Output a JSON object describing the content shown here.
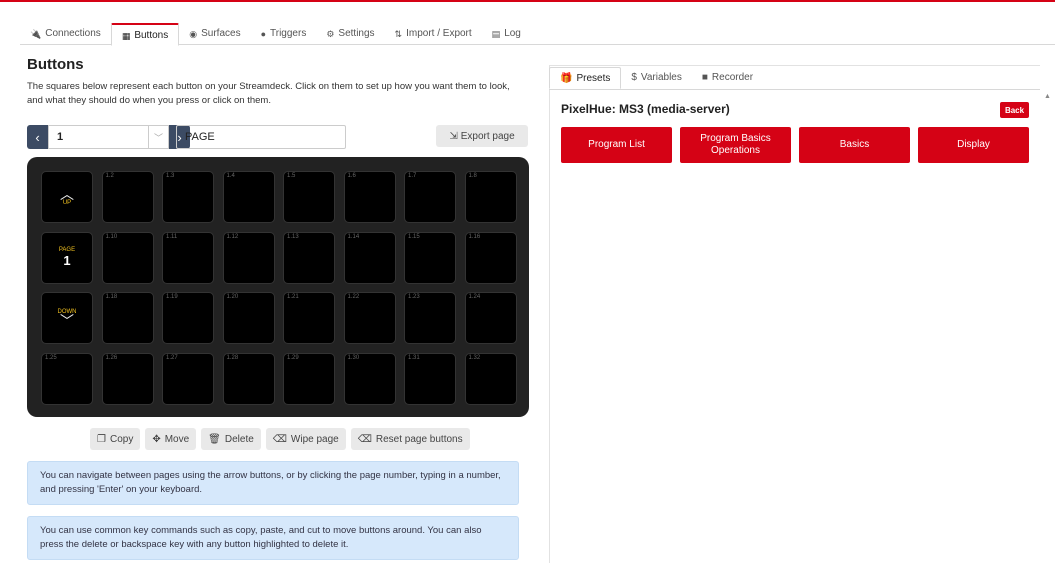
{
  "nav": {
    "tabs": [
      {
        "icon": "plug-icon",
        "glyph": "🔌",
        "label": "Connections"
      },
      {
        "icon": "calculator-icon",
        "glyph": "▦",
        "label": "Buttons",
        "active": true
      },
      {
        "icon": "gamepad-icon",
        "glyph": "◉",
        "label": "Surfaces"
      },
      {
        "icon": "clock-icon",
        "glyph": "●",
        "label": "Triggers"
      },
      {
        "icon": "gear-icon",
        "glyph": "⚙",
        "label": "Settings"
      },
      {
        "icon": "file-import-icon",
        "glyph": "⇅",
        "label": "Import / Export"
      },
      {
        "icon": "clipboard-icon",
        "glyph": "▤",
        "label": "Log"
      }
    ]
  },
  "left": {
    "title": "Buttons",
    "description": "The squares below represent each button on your Streamdeck. Click on them to set up how you want them to look, and what they should do when you press or click on them.",
    "page_number": "1",
    "page_name": "PAGE",
    "export_label": "Export page",
    "nav_buttons": {
      "up": "UP",
      "page": "PAGE",
      "page_num": "1",
      "down": "DOWN"
    },
    "grid_labels": [
      [
        "",
        "1.2",
        "1.3",
        "1.4",
        "1.5",
        "1.6",
        "1.7",
        "1.8"
      ],
      [
        "",
        "1.10",
        "1.11",
        "1.12",
        "1.13",
        "1.14",
        "1.15",
        "1.16"
      ],
      [
        "",
        "1.18",
        "1.19",
        "1.20",
        "1.21",
        "1.22",
        "1.23",
        "1.24"
      ],
      [
        "1.25",
        "1.26",
        "1.27",
        "1.28",
        "1.29",
        "1.30",
        "1.31",
        "1.32"
      ]
    ],
    "actions": [
      {
        "icon": "copy-icon",
        "glyph": "❐",
        "label": "Copy"
      },
      {
        "icon": "move-icon",
        "glyph": "✥",
        "label": "Move"
      },
      {
        "icon": "trash-icon",
        "glyph": "🗑",
        "label": "Delete"
      },
      {
        "icon": "eraser-icon",
        "glyph": "⌫",
        "label": "Wipe page"
      },
      {
        "icon": "eraser-icon",
        "glyph": "⌫",
        "label": "Reset page buttons"
      }
    ],
    "info1": "You can navigate between pages using the arrow buttons, or by clicking the page number, typing in a number, and pressing 'Enter' on your keyboard.",
    "info2": "You can use common key commands such as copy, paste, and cut to move buttons around. You can also press the delete or backspace key with any button highlighted to delete it."
  },
  "right": {
    "tabs": [
      {
        "icon": "gift-icon",
        "glyph": "🎁",
        "label": "Presets",
        "active": true
      },
      {
        "icon": "dollar-icon",
        "glyph": "$",
        "label": "Variables"
      },
      {
        "icon": "video-icon",
        "glyph": "■",
        "label": "Recorder"
      }
    ],
    "module_title": "PixelHue: MS3 (media-server)",
    "back_label": "Back",
    "presets": [
      "Program List",
      "Program Basics Operations",
      "Basics",
      "Display"
    ]
  },
  "colors": {
    "accent": "#d50215",
    "info_bg": "#d6e8fb",
    "deck_bg": "#222222"
  }
}
